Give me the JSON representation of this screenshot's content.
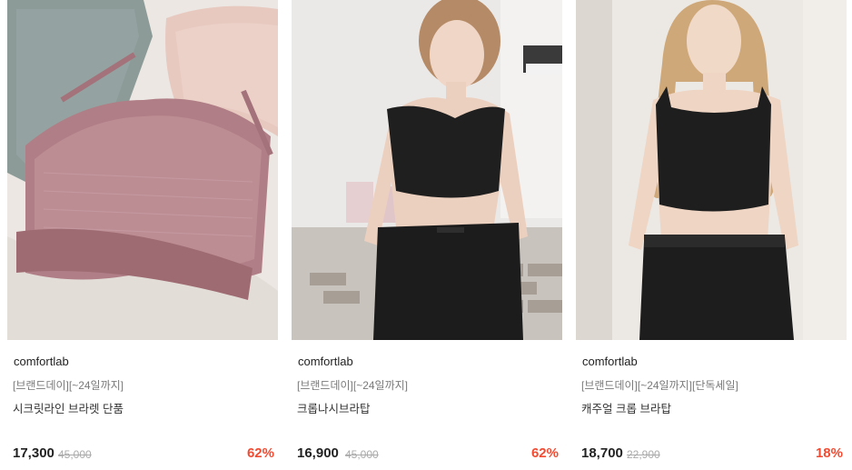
{
  "products": [
    {
      "image_alt": "lace bralette set",
      "brand": "comfortlab",
      "promo": "[브랜드데이][~24일까지]",
      "name": "시크릿라인 브라렛 단품",
      "price": "17,300",
      "original_price": "45,000",
      "discount": "62%"
    },
    {
      "image_alt": "model in black crop bra top",
      "brand": "comfortlab",
      "promo": "[브랜드데이][~24일까지]",
      "name": "크롭나시브라탑",
      "price": "16,900",
      "original_price": "45,000",
      "discount": "62%"
    },
    {
      "image_alt": "model in black casual crop bra top",
      "brand": "comfortlab",
      "promo": "[브랜드데이][~24일까지][단독세일]",
      "name": "캐주얼 크롭 브라탑",
      "price": "18,700",
      "original_price": "22,900",
      "discount": "18%"
    }
  ],
  "colors": {
    "discount": "#f24b32",
    "price": "#222222",
    "original_price": "#aaaaaa",
    "promo": "#7a7a7a"
  }
}
